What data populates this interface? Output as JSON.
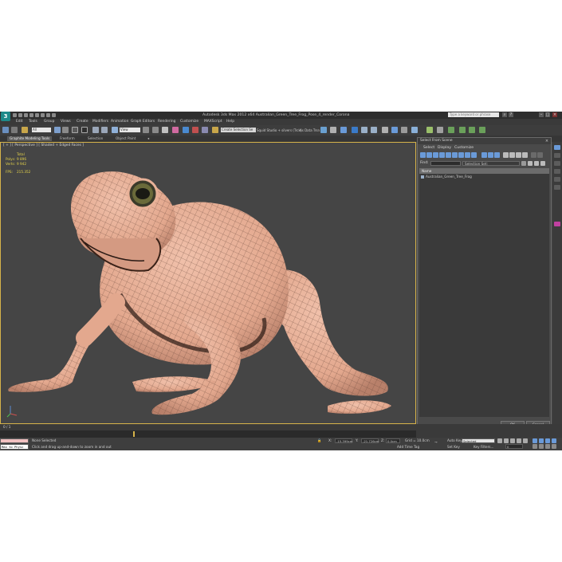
{
  "app": {
    "window_title": "Autodesk 3ds Max 2012 x64      Australian_Green_Tree_Frog_Pose_4_render_Corona",
    "logo_text": "3",
    "search_placeholder": "Type a keyword or phrase"
  },
  "menu": [
    "Edit",
    "Tools",
    "Group",
    "Views",
    "Create",
    "Modifiers",
    "Animation",
    "Graph Editors",
    "Rendering",
    "Customize",
    "MAXScript",
    "Help"
  ],
  "toolbar": {
    "selection_filter": "All",
    "coord_system": "View",
    "named_selection": "Create Selection Se",
    "render_preset": "Squid Studio + silvers (Trck)",
    "render_label": "As Data Trsn"
  },
  "ribbon": {
    "tabs": [
      "Graphite Modeling Tools",
      "Freeform",
      "Selection",
      "Object Paint"
    ],
    "active_tab": "Graphite Modeling Tools"
  },
  "viewport": {
    "label": "[ + ] [ Perspective ] [ Shaded + Edged Faces ]",
    "stats_header": "Total",
    "polys_label": "Polys:",
    "polys_value": "9 896",
    "verts_label": "Verts:",
    "verts_value": "9 942",
    "fps_label": "FPS:",
    "fps_value": "215.352"
  },
  "dialog": {
    "title": "Select From Scene",
    "menu": [
      "Select",
      "Display",
      "Customize"
    ],
    "find_label": "Find:",
    "selection_set_label": "Selection Set:",
    "column_header": "Name",
    "items": [
      "Australian_Green_Tree_Frog"
    ],
    "ok_label": "OK",
    "cancel_label": "Cancel"
  },
  "timeline": {
    "frame_label": "0 / 1"
  },
  "status": {
    "script_listener": "Max to Physc",
    "selection_text": "None Selected",
    "prompt_text": "Click and drag up-and-down to zoom in and out",
    "x_label": "X:",
    "x_value": "-15.399cm",
    "y_label": "Y:",
    "y_value": "-21.726cm",
    "z_label": "Z:",
    "z_value": "0.0cm",
    "grid_text": "Grid = 10.0cm",
    "add_time_tag": "Add Time Tag",
    "auto_key_label": "Auto Key",
    "auto_key_value": "Selected",
    "set_key_label": "Set Key",
    "key_filters_label": "Key Filters...",
    "frame_value": "0"
  },
  "colors": {
    "frog_skin": "#e8b198",
    "frog_shadow": "#b8806a",
    "mesh_line": "#6b4a3c",
    "viewport_bg": "#454545",
    "active_border": "#d6b34a"
  }
}
